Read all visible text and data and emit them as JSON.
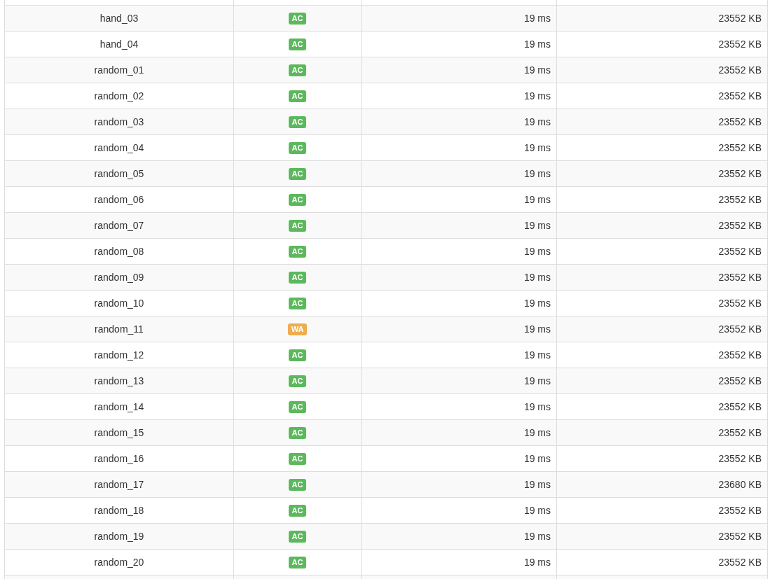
{
  "table": {
    "rows": [
      {
        "column_1": "hand_03",
        "column_2": {
          "text": "AC",
          "color": "#5cb85c"
        },
        "column_3": "19 ms",
        "column_4": "23552 KB"
      },
      {
        "column_1": "hand_04",
        "column_2": {
          "text": "AC",
          "color": "#5cb85c"
        },
        "column_3": "19 ms",
        "column_4": "23552 KB"
      },
      {
        "column_1": "random_01",
        "column_2": {
          "text": "AC",
          "color": "#5cb85c"
        },
        "column_3": "19 ms",
        "column_4": "23552 KB"
      },
      {
        "column_1": "random_02",
        "column_2": {
          "text": "AC",
          "color": "#5cb85c"
        },
        "column_3": "19 ms",
        "column_4": "23552 KB"
      },
      {
        "column_1": "random_03",
        "column_2": {
          "text": "AC",
          "color": "#5cb85c"
        },
        "column_3": "19 ms",
        "column_4": "23552 KB"
      },
      {
        "column_1": "random_04",
        "column_2": {
          "text": "AC",
          "color": "#5cb85c"
        },
        "column_3": "19 ms",
        "column_4": "23552 KB"
      },
      {
        "column_1": "random_05",
        "column_2": {
          "text": "AC",
          "color": "#5cb85c"
        },
        "column_3": "19 ms",
        "column_4": "23552 KB"
      },
      {
        "column_1": "random_06",
        "column_2": {
          "text": "AC",
          "color": "#5cb85c"
        },
        "column_3": "19 ms",
        "column_4": "23552 KB"
      },
      {
        "column_1": "random_07",
        "column_2": {
          "text": "AC",
          "color": "#5cb85c"
        },
        "column_3": "19 ms",
        "column_4": "23552 KB"
      },
      {
        "column_1": "random_08",
        "column_2": {
          "text": "AC",
          "color": "#5cb85c"
        },
        "column_3": "19 ms",
        "column_4": "23552 KB"
      },
      {
        "column_1": "random_09",
        "column_2": {
          "text": "AC",
          "color": "#5cb85c"
        },
        "column_3": "19 ms",
        "column_4": "23552 KB"
      },
      {
        "column_1": "random_10",
        "column_2": {
          "text": "AC",
          "color": "#5cb85c"
        },
        "column_3": "19 ms",
        "column_4": "23552 KB"
      },
      {
        "column_1": "random_11",
        "column_2": {
          "text": "WA",
          "color": "#f0ad4e"
        },
        "column_3": "19 ms",
        "column_4": "23552 KB"
      },
      {
        "column_1": "random_12",
        "column_2": {
          "text": "AC",
          "color": "#5cb85c"
        },
        "column_3": "19 ms",
        "column_4": "23552 KB"
      },
      {
        "column_1": "random_13",
        "column_2": {
          "text": "AC",
          "color": "#5cb85c"
        },
        "column_3": "19 ms",
        "column_4": "23552 KB"
      },
      {
        "column_1": "random_14",
        "column_2": {
          "text": "AC",
          "color": "#5cb85c"
        },
        "column_3": "19 ms",
        "column_4": "23552 KB"
      },
      {
        "column_1": "random_15",
        "column_2": {
          "text": "AC",
          "color": "#5cb85c"
        },
        "column_3": "19 ms",
        "column_4": "23552 KB"
      },
      {
        "column_1": "random_16",
        "column_2": {
          "text": "AC",
          "color": "#5cb85c"
        },
        "column_3": "19 ms",
        "column_4": "23552 KB"
      },
      {
        "column_1": "random_17",
        "column_2": {
          "text": "AC",
          "color": "#5cb85c"
        },
        "column_3": "19 ms",
        "column_4": "23680 KB"
      },
      {
        "column_1": "random_18",
        "column_2": {
          "text": "AC",
          "color": "#5cb85c"
        },
        "column_3": "19 ms",
        "column_4": "23552 KB"
      },
      {
        "column_1": "random_19",
        "column_2": {
          "text": "AC",
          "color": "#5cb85c"
        },
        "column_3": "19 ms",
        "column_4": "23552 KB"
      },
      {
        "column_1": "random_20",
        "column_2": {
          "text": "AC",
          "color": "#5cb85c"
        },
        "column_3": "19 ms",
        "column_4": "23552 KB"
      }
    ]
  }
}
